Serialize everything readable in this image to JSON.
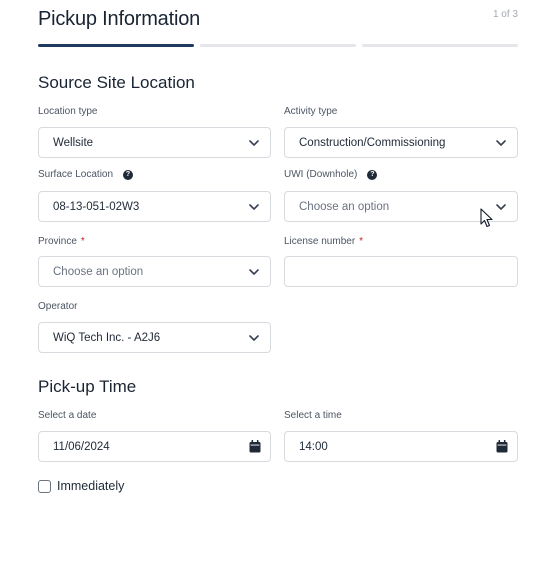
{
  "header": {
    "title": "Pickup Information",
    "step_counter": "1 of 3"
  },
  "progress": {
    "total_steps": 3,
    "current_step": 1
  },
  "source_site": {
    "section_title": "Source Site Location",
    "location_type": {
      "label": "Location type",
      "value": "Wellsite"
    },
    "activity_type": {
      "label": "Activity type",
      "value": "Construction/Commissioning"
    },
    "surface_location": {
      "label": "Surface Location",
      "value": "08-13-051-02W3"
    },
    "uwi": {
      "label": "UWI (Downhole)",
      "placeholder": "Choose an option"
    },
    "province": {
      "label": "Province",
      "required_mark": "*",
      "placeholder": "Choose an option"
    },
    "license_number": {
      "label": "License number",
      "required_mark": "*",
      "value": ""
    },
    "operator": {
      "label": "Operator",
      "value": "WiQ Tech Inc. - A2J6"
    }
  },
  "pickup_time": {
    "section_title": "Pick-up Time",
    "date": {
      "label": "Select a date",
      "value": "11/06/2024"
    },
    "time": {
      "label": "Select a time",
      "value": "14:00"
    },
    "immediately": {
      "label": "Immediately",
      "checked": false
    }
  },
  "colors": {
    "accent": "#1e3a5f",
    "required": "#c81e1e",
    "border": "#d7dbe0"
  },
  "icons": {
    "info": "info-icon",
    "chevron": "chevron-down-icon",
    "calendar": "calendar-icon",
    "cursor": "mouse-cursor-icon"
  }
}
